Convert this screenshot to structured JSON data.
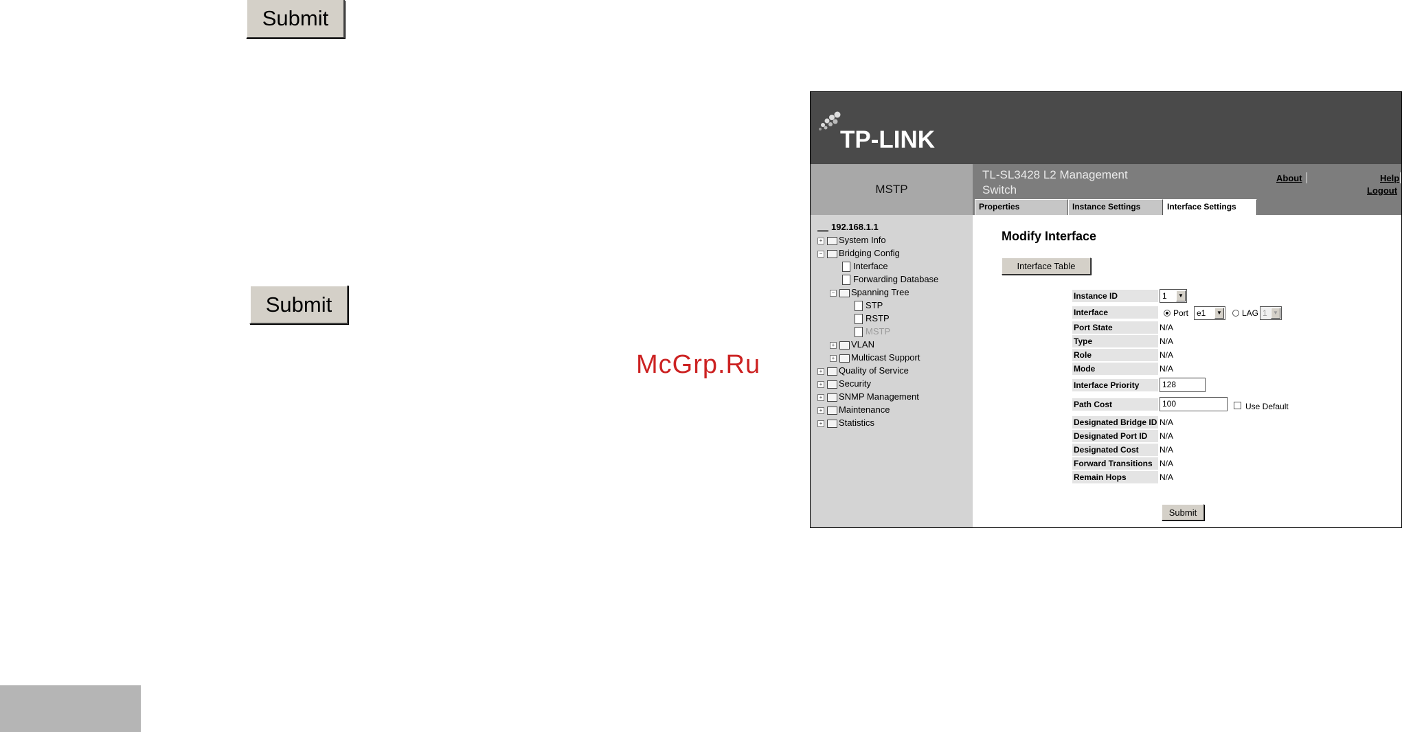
{
  "page": {
    "submit_top_label": "Submit",
    "submit_mid_label": "Submit",
    "watermark": "McGrp.Ru"
  },
  "screenshot": {
    "logo": "TP-LINK",
    "section_title": "MSTP",
    "product_name": "TL-SL3428 L2 Management Switch",
    "links": {
      "about": "About",
      "help": "Help",
      "logout": "Logout"
    },
    "tabs": [
      {
        "label": "Properties",
        "active": false
      },
      {
        "label": "Instance Settings",
        "active": false
      },
      {
        "label": "Interface Settings",
        "active": true
      }
    ],
    "tree": {
      "root": "192.168.1.1",
      "items": [
        {
          "label": "System Info",
          "expander": "+"
        },
        {
          "label": "Bridging Config",
          "expander": "-"
        },
        {
          "label": "Interface"
        },
        {
          "label": "Forwarding Database"
        },
        {
          "label": "Spanning Tree",
          "expander": "-"
        },
        {
          "label": "STP"
        },
        {
          "label": "RSTP"
        },
        {
          "label": "MSTP"
        },
        {
          "label": "VLAN",
          "expander": "+"
        },
        {
          "label": "Multicast Support",
          "expander": "+"
        },
        {
          "label": "Quality of Service",
          "expander": "+"
        },
        {
          "label": "Security",
          "expander": "+"
        },
        {
          "label": "SNMP Management",
          "expander": "+"
        },
        {
          "label": "Maintenance",
          "expander": "+"
        },
        {
          "label": "Statistics",
          "expander": "+"
        }
      ]
    },
    "form": {
      "title": "Modify Interface",
      "table_button": "Interface Table",
      "labels": {
        "instance_id": "Instance ID",
        "interface": "Interface",
        "port_state": "Port State",
        "type": "Type",
        "role": "Role",
        "mode": "Mode",
        "interface_priority": "Interface Priority",
        "path_cost": "Path Cost",
        "designated_bridge_id": "Designated Bridge ID",
        "designated_port_id": "Designated Port ID",
        "designated_cost": "Designated Cost",
        "forward_transitions": "Forward Transitions",
        "remain_hops": "Remain Hops"
      },
      "values": {
        "instance_id": "1",
        "port_radio_label": "Port",
        "port_value": "e1",
        "lag_radio_label": "LAG",
        "lag_value": "1",
        "port_state": "N/A",
        "type": "N/A",
        "role": "N/A",
        "mode": "N/A",
        "interface_priority": "128",
        "path_cost": "100",
        "use_default_label": "Use Default",
        "designated_bridge_id": "N/A",
        "designated_port_id": "N/A",
        "designated_cost": "N/A",
        "forward_transitions": "N/A",
        "remain_hops": "N/A"
      },
      "submit_label": "Submit"
    }
  },
  "colors": {
    "banner": "#4a4a4a",
    "sidebar": "#d4d4d4",
    "title_bar": "#7d7d7d",
    "watermark": "#cc2222"
  }
}
